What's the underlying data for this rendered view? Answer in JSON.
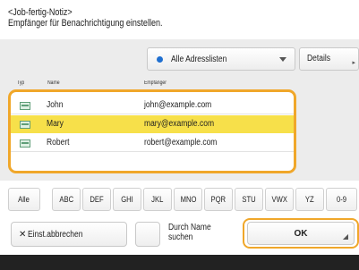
{
  "header": {
    "title": "<Job-fertig-Notiz>",
    "subtitle": "Empfänger für Benachrichtigung einstellen."
  },
  "address_list": {
    "selected": "Alle Adresslisten",
    "icon": "globe-dot-icon"
  },
  "details_button": "Details",
  "columns": {
    "type": "Typ",
    "name": "Name",
    "recipient": "Empfänger"
  },
  "rows": [
    {
      "name": "John",
      "email": "john@example.com",
      "selected": false
    },
    {
      "name": "Mary",
      "email": "mary@example.com",
      "selected": true
    },
    {
      "name": "Robert",
      "email": "robert@example.com",
      "selected": false
    }
  ],
  "alpha_tabs": [
    "Alle",
    "ABC",
    "DEF",
    "GHI",
    "JKL",
    "MNO",
    "PQR",
    "STU",
    "VWX",
    "YZ",
    "0-9"
  ],
  "buttons": {
    "cancel": "Einst.abbrechen",
    "sort_by_name_line1": "Durch Name",
    "sort_by_name_line2": "suchen",
    "ok": "OK"
  },
  "colors": {
    "accent": "#f0a72a",
    "selection": "#f7e04a",
    "globe": "#1f6fd0"
  }
}
